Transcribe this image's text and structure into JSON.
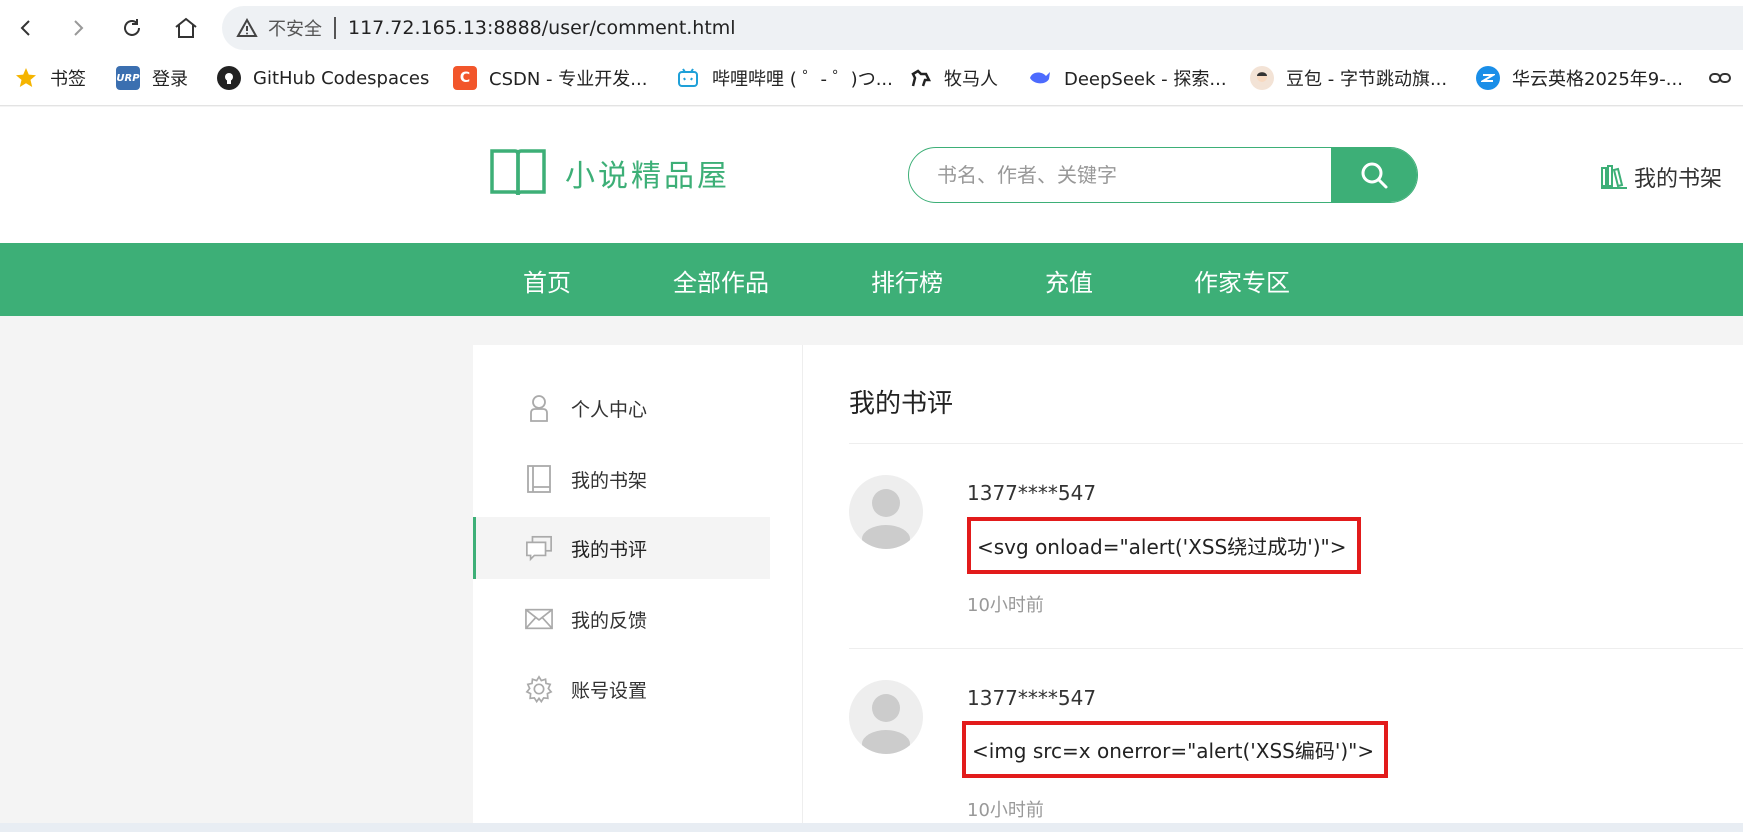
{
  "browser": {
    "insecure_label": "不安全",
    "url": "117.72.165.13:8888/user/comment.html",
    "bookmarks": [
      {
        "label": "书签",
        "icon": "star-icon"
      },
      {
        "label": "登录",
        "icon": "urp-icon",
        "icon_text": "URP"
      },
      {
        "label": "GitHub Codespaces",
        "icon": "github-icon"
      },
      {
        "label": "CSDN - 专业开发...",
        "icon": "csdn-icon",
        "icon_text": "C"
      },
      {
        "label": "哔哩哔哩 ( ゜- ゜)つ...",
        "icon": "bilibili-icon"
      },
      {
        "label": "牧马人",
        "icon": "horse-icon"
      },
      {
        "label": "DeepSeek - 探索...",
        "icon": "deepseek-icon"
      },
      {
        "label": "豆包 - 字节跳动旗...",
        "icon": "doubao-icon"
      },
      {
        "label": "华云英格2025年9-...",
        "icon": "huayun-icon"
      }
    ]
  },
  "header": {
    "logo_text": "小说精品屋",
    "search_placeholder": "书名、作者、关键字",
    "shelf_label": "我的书架"
  },
  "nav": {
    "items": [
      "首页",
      "全部作品",
      "排行榜",
      "充值",
      "作家专区"
    ]
  },
  "sidebar": {
    "items": [
      {
        "label": "个人中心",
        "icon": "user-icon"
      },
      {
        "label": "我的书架",
        "icon": "book-icon"
      },
      {
        "label": "我的书评",
        "icon": "comment-icon",
        "active": true
      },
      {
        "label": "我的反馈",
        "icon": "mail-icon"
      },
      {
        "label": "账号设置",
        "icon": "gear-icon"
      }
    ]
  },
  "main": {
    "title": "我的书评",
    "comments": [
      {
        "user": "1377****547",
        "text": "<svg onload=\"alert('XSS绕过成功')\">",
        "time": "10小时前"
      },
      {
        "user": "1377****547",
        "text": "<img src=x onerror=\"alert('XSS编码')\">",
        "time": "10小时前"
      }
    ]
  },
  "colors": {
    "brand_green": "#3daf77",
    "highlight_red": "#e21b1b"
  }
}
